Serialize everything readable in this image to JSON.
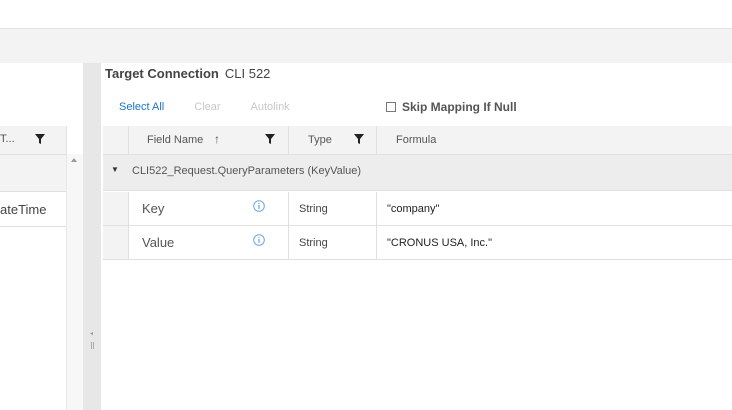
{
  "left_panel": {
    "column_header": "T...",
    "row_value": "ateTime"
  },
  "target": {
    "title_label": "Target Connection",
    "connection_name": "CLI 522"
  },
  "toolbar": {
    "select_all": "Select All",
    "clear": "Clear",
    "autolink": "Autolink"
  },
  "skip_mapping": {
    "label": "Skip Mapping If Null",
    "checked": false
  },
  "grid": {
    "columns": {
      "field_name": "Field Name",
      "sort_indicator": "↑",
      "type": "Type",
      "formula": "Formula"
    },
    "group": {
      "expanded_indicator": "▼",
      "label": "CLI522_Request.QueryParameters (KeyValue)"
    },
    "rows": [
      {
        "field": "Key",
        "type": "String",
        "formula": "\"company\""
      },
      {
        "field": "Value",
        "type": "String",
        "formula": "\"CRONUS USA, Inc.\""
      }
    ]
  },
  "colors": {
    "accent": "#1a73c8",
    "disabled": "#c8c8c8",
    "info_icon": "#6aa6e0"
  },
  "icons": [
    "filter-icon",
    "info-icon",
    "sort-ascending-icon",
    "expand-triangle-icon",
    "scroll-up-icon",
    "splitter-arrow-icon"
  ]
}
